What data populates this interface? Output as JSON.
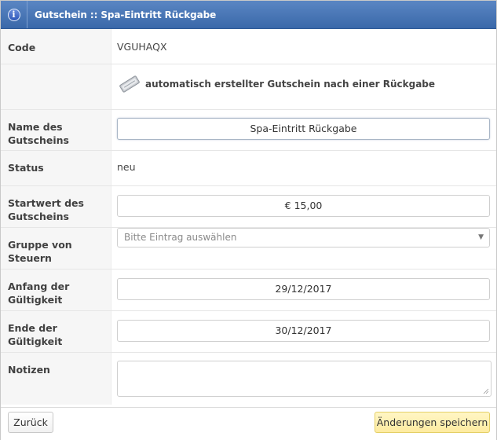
{
  "window": {
    "title": "Gutschein :: Spa-Eintritt Rückgabe",
    "info_icon": "i"
  },
  "form": {
    "code": {
      "label": "Code",
      "value": "VGUHAQX"
    },
    "notice": {
      "icon": "voucher-icon",
      "text": "automatisch erstellter Gutschein nach einer Rückgabe"
    },
    "name": {
      "label_line1": "Name des",
      "label_line2": "Gutscheins",
      "value": "Spa-Eintritt Rückgabe"
    },
    "status": {
      "label": "Status",
      "value": "neu"
    },
    "start_value": {
      "label_line1": "Startwert des",
      "label_line2": "Gutscheins",
      "value": "€ 15,00"
    },
    "tax_group": {
      "label_line1": "Gruppe von",
      "label_line2": "Steuern",
      "placeholder": "Bitte Eintrag auswählen"
    },
    "valid_from": {
      "label_line1": "Anfang der",
      "label_line2": "Gültigkeit",
      "value": "29/12/2017"
    },
    "valid_to": {
      "label_line1": "Ende der",
      "label_line2": "Gültigkeit",
      "value": "30/12/2017"
    },
    "notes": {
      "label": "Notizen",
      "value": ""
    }
  },
  "footer": {
    "back_label": "Zurück",
    "save_label": "Änderungen speichern"
  }
}
